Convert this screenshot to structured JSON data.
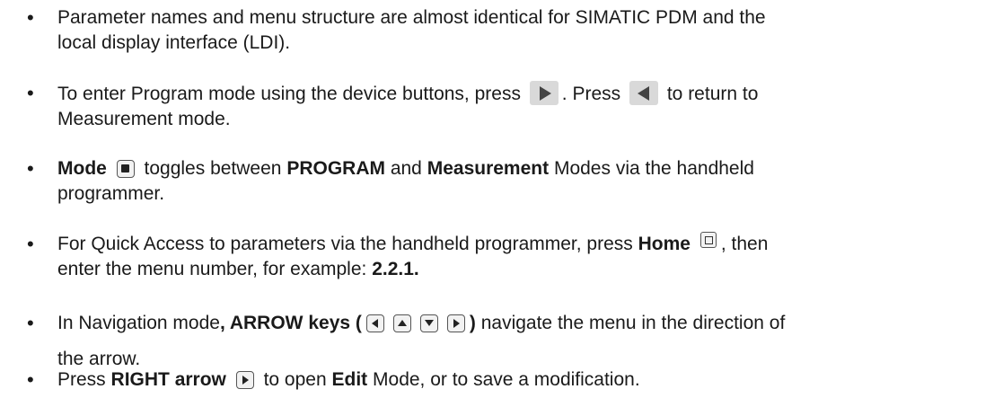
{
  "bullets": [
    {
      "line1": "Parameter names and menu structure are almost identical for SIMATIC PDM and the",
      "line2": "local display interface (LDI)."
    },
    {
      "part1": "To enter Program mode using the device buttons, press",
      "part2": ". Press",
      "part3": "to return to",
      "line2": "Measurement mode."
    },
    {
      "bold1": "Mode",
      "part1": "toggles between",
      "bold2": "PROGRAM",
      "part2": "and",
      "bold3": "Measurement",
      "part3": "Modes via the handheld",
      "line2": "programmer."
    },
    {
      "part1": "For Quick Access to parameters via the handheld programmer, press",
      "bold1": "Home",
      "part2": ", then",
      "line2a": "enter the menu number, for example:",
      "bold2": "2.2.1."
    },
    {
      "part1": "In Navigation mode",
      "bold1": ", ARROW keys (",
      "bold2": ")",
      "part2": "navigate the menu in the direction of",
      "line2": "the arrow."
    },
    {
      "part1": "Press",
      "bold1": "RIGHT arrow",
      "part2": "to open",
      "bold2": "Edit",
      "part3": "Mode, or to save a modification."
    }
  ],
  "icons": {
    "device_right": "device-right-arrow-button-icon",
    "device_left": "device-left-arrow-button-icon",
    "mode_key": "mode-key-icon",
    "home_key": "home-key-icon",
    "arrow_left": "left-arrow-key-icon",
    "arrow_up": "up-arrow-key-icon",
    "arrow_down": "down-arrow-key-icon",
    "arrow_right": "right-arrow-key-icon"
  },
  "colors": {
    "text": "#1a1a1a",
    "device_button_bg": "#d9d9d9"
  }
}
